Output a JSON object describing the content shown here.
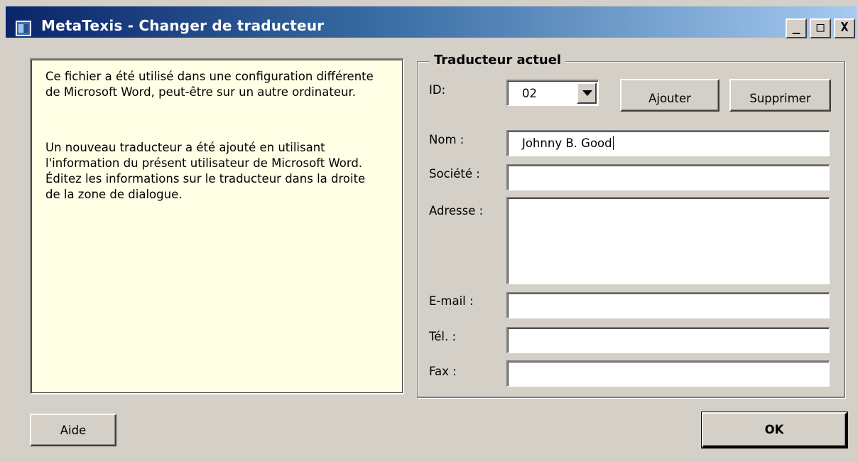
{
  "window": {
    "title": "MetaTexis - Changer de traducteur",
    "controls": {
      "minimize": "_",
      "maximize": "□",
      "close": "X"
    }
  },
  "info": {
    "paragraph1": "Ce fichier a été utilisé dans une configuration différente de Microsoft Word, peut-être sur un autre ordinateur.",
    "paragraph2": "Un nouveau traducteur a été ajouté en utilisant l'information du présent utilisateur de Microsoft Word. Éditez les informations sur le traducteur dans la droite de la zone de dialogue."
  },
  "translator": {
    "group_title": "Traducteur actuel",
    "id_label": "ID:",
    "id_value": "02",
    "add_label": "Ajouter",
    "delete_label": "Supprimer",
    "name_label": "Nom :",
    "name_value": "Johnny B. Good",
    "company_label": "Société :",
    "company_value": "",
    "address_label": "Adresse :",
    "address_value": "",
    "email_label": "E-mail :",
    "email_value": "",
    "phone_label": "Tél. :",
    "phone_value": "",
    "fax_label": "Fax :",
    "fax_value": ""
  },
  "footer": {
    "help_label": "Aide",
    "ok_label": "OK"
  },
  "colors": {
    "dialog_bg": "#d4d0c8",
    "info_bg": "#ffffe6",
    "titlebar_start": "#0a246a",
    "titlebar_end": "#a6caf0"
  }
}
